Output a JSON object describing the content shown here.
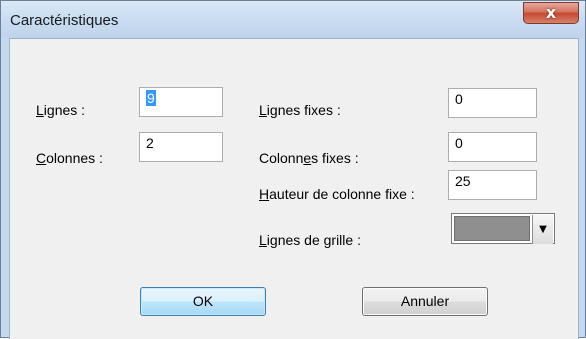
{
  "window": {
    "title": "Caractéristiques",
    "close_label": "x"
  },
  "fields": {
    "lignes": {
      "label_first": "L",
      "label_rest": "ignes :",
      "value": "9"
    },
    "colonnes": {
      "label_first": "C",
      "label_rest": "olonnes :",
      "value": "2"
    },
    "lignes_fixes": {
      "label_first": "L",
      "label_rest": "ignes fixes :",
      "value": "0"
    },
    "colonnes_fixes": {
      "label_pre": "Colonn",
      "label_ul": "e",
      "label_post": "s fixes :",
      "value": "0"
    },
    "hauteur": {
      "label_first": "H",
      "label_rest": "auteur de colonne fixe :",
      "value": "25"
    },
    "lignes_grille": {
      "label_first": "L",
      "label_rest": "ignes de grille :",
      "color": "#8f8f8f"
    }
  },
  "buttons": {
    "ok": "OK",
    "cancel": "Annuler"
  },
  "icons": {
    "close": "close-icon",
    "dropdown": "chevron-down-icon"
  }
}
